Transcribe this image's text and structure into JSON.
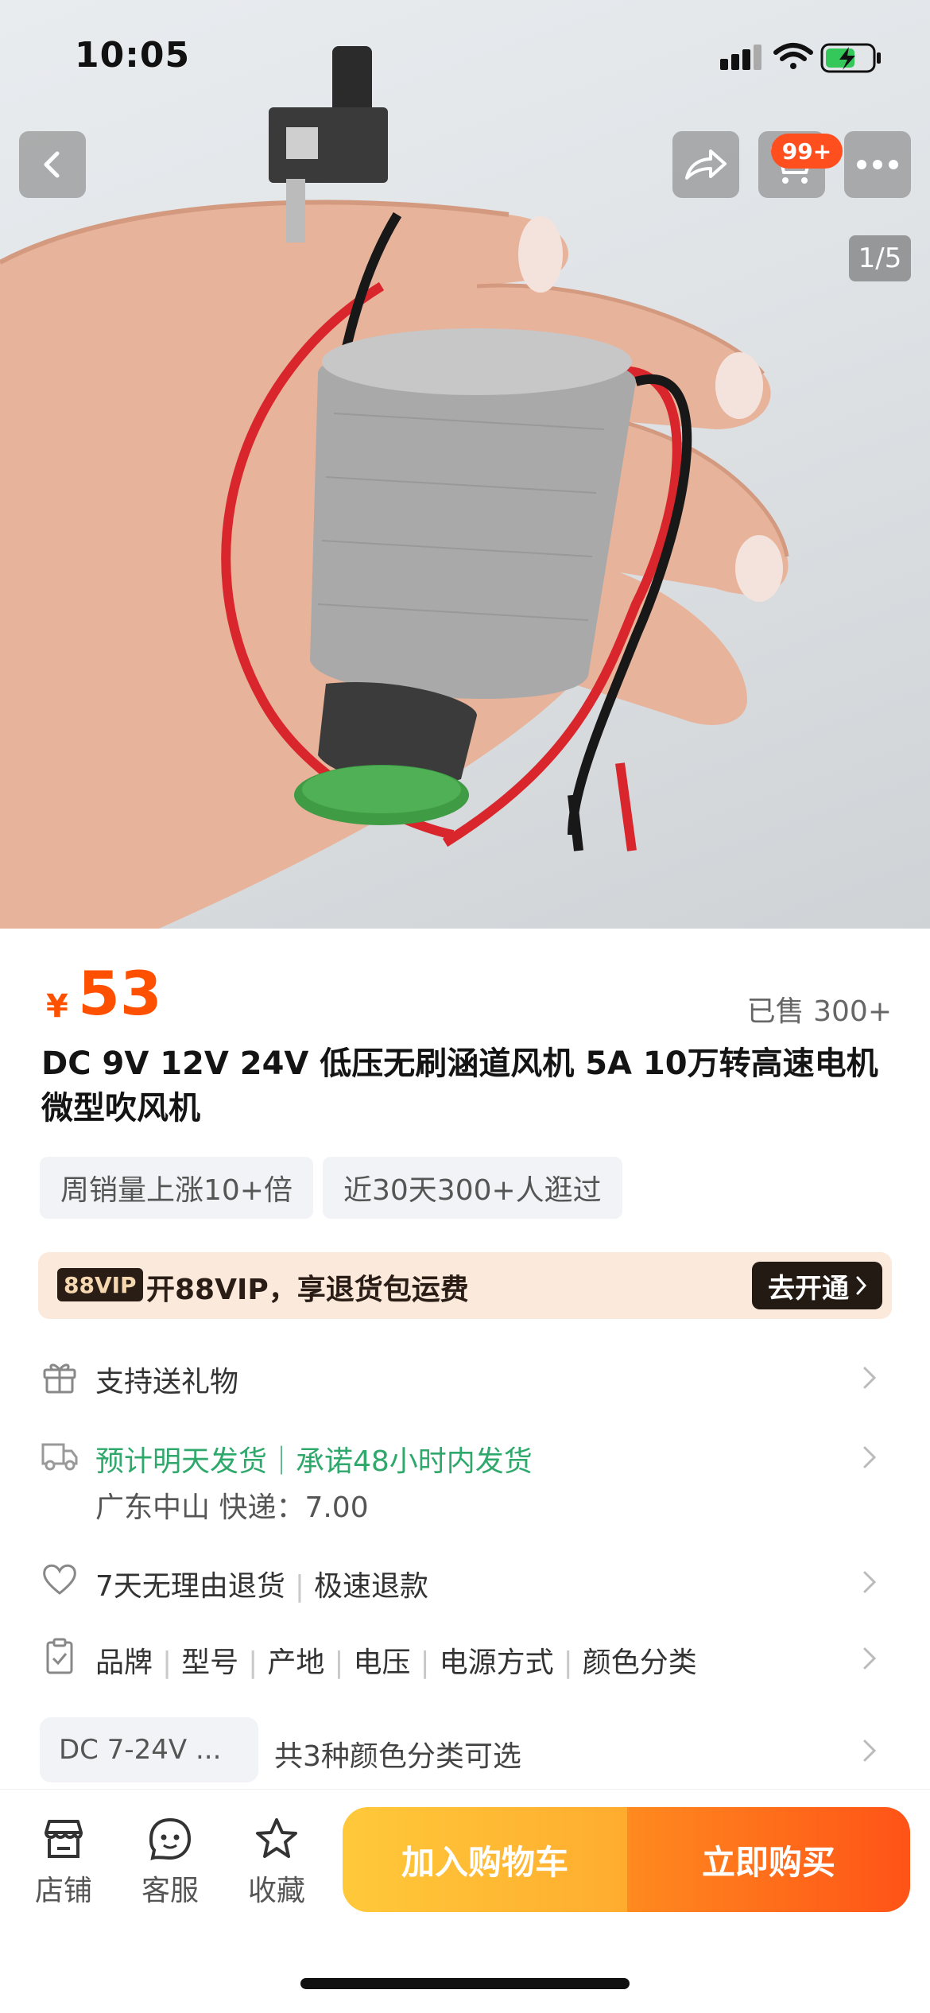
{
  "status_bar": {
    "time": "10:05"
  },
  "gallery": {
    "counter": "1/5",
    "cart_badge": "99+"
  },
  "product": {
    "currency": "¥",
    "price": "53",
    "sold": "已售 300+",
    "title": "DC 9V 12V 24V 低压无刷涵道风机 5A 10万转高速电机 微型吹风机",
    "tags": [
      "周销量上涨10+倍",
      "近30天300+人逛过"
    ]
  },
  "vip": {
    "logo": "88VIP",
    "text": "开88VIP，享退货包运费",
    "button": "去开通"
  },
  "services": {
    "gift": "支持送礼物",
    "shipping_main": "预计明天发货｜承诺48小时内发货",
    "shipping_origin": "广东中山  快递：7.00",
    "returns_a": "7天无理由退货",
    "returns_b": "极速退款",
    "params": [
      "品牌",
      "型号",
      "产地",
      "电压",
      "电源方式",
      "颜色分类"
    ],
    "color_chip": "DC 7-24V ...",
    "color_text": "共3种颜色分类可选"
  },
  "bottom_bar": {
    "shop": "店铺",
    "service": "客服",
    "favorite": "收藏",
    "add_to_cart": "加入购物车",
    "buy_now": "立即购买"
  },
  "colors": {
    "accent": "#ff5000",
    "green": "#2fa86c"
  }
}
